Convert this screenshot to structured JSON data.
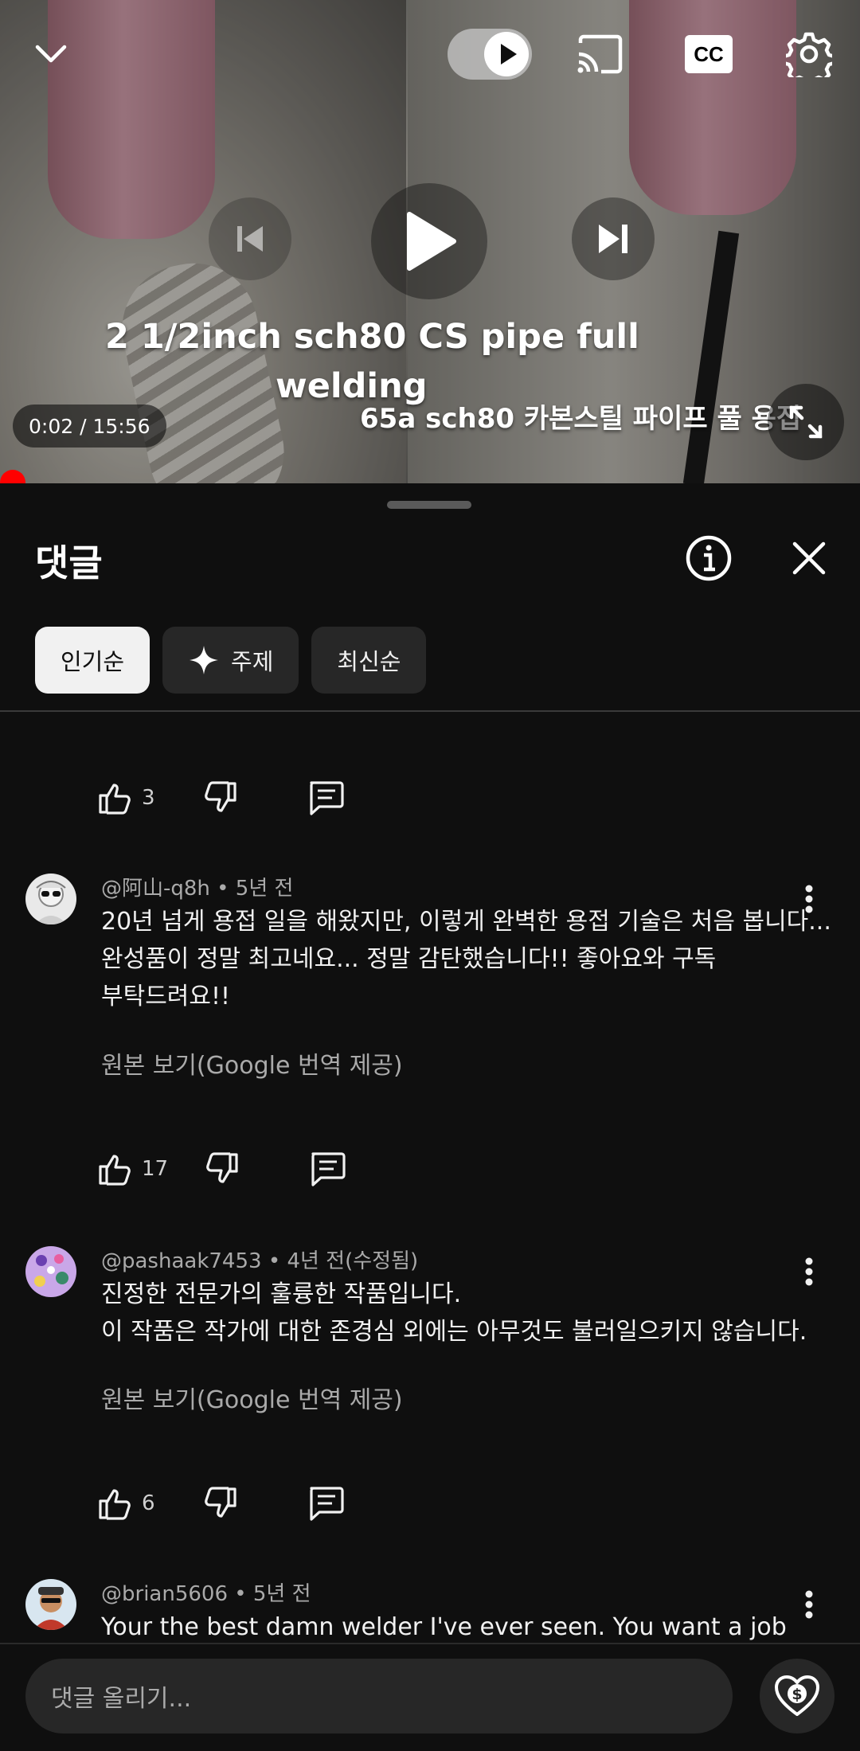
{
  "player": {
    "title_line_1": "2 1/2inch sch80 CS pipe full",
    "title_line_2": "welding",
    "title_korean": "65a sch80 카본스틸 파이프 풀 용접",
    "time": "0:02 / 15:56",
    "autoplay": "on",
    "cc_label": "CC"
  },
  "comments_panel": {
    "title": "댓글",
    "filters": [
      {
        "label": "인기순",
        "active": true
      },
      {
        "label": "주제",
        "active": false
      },
      {
        "label": "최신순",
        "active": false
      }
    ],
    "partial_comment_likes": "3",
    "comments": [
      {
        "author": "@阿山-q8h",
        "time": "5년 전",
        "lines": [
          "20년 넘게 용접 일을 해왔지만, 이렇게 완벽한 용접 기술은 처음 봅니다...",
          "완성품이 정말 최고네요... 정말 감탄했습니다!! 좋아요와 구독",
          "부탁드려요!!"
        ],
        "translation_note": "원본 보기(Google 번역 제공)",
        "likes": "17"
      },
      {
        "author": "@pashaak7453",
        "time": "4년 전(수정됨)",
        "lines": [
          "진정한 전문가의 훌륭한 작품입니다.",
          "이 작품은 작가에 대한 존경심 외에는 아무것도 불러일으키지 않습니다."
        ],
        "translation_note": "원본 보기(Google 번역 제공)",
        "likes": "6"
      },
      {
        "author": "@brian5606",
        "time": "5년 전",
        "lines": [
          "Your the best damn welder I've ever seen. You want a job"
        ]
      }
    ],
    "input_placeholder": "댓글 올리기..."
  },
  "colors": {
    "background": "#0f0f0f",
    "chip_bg": "#272727",
    "chip_active_bg": "#f1f1f1",
    "progress": "#ff0000",
    "secondary_text": "#aaaaaa"
  }
}
